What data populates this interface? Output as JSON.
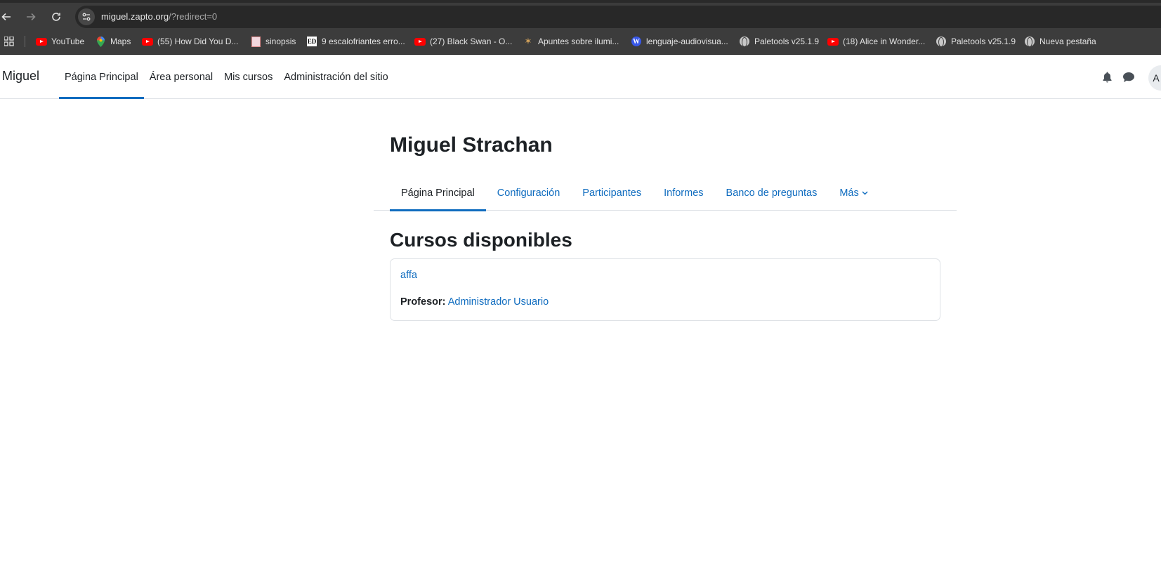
{
  "browser": {
    "url_host": "miguel.zapto.org",
    "url_path": "/?redirect=0",
    "bookmarks": [
      {
        "label": "YouTube",
        "icon": "youtube-icon"
      },
      {
        "label": "Maps",
        "icon": "maps-icon"
      },
      {
        "label": "(55) How Did You D...",
        "icon": "youtube-icon"
      },
      {
        "label": "sinopsis",
        "icon": "document-icon"
      },
      {
        "label": "9 escalofriantes erro...",
        "icon": "ed-icon"
      },
      {
        "label": "(27) Black Swan - O...",
        "icon": "youtube-icon"
      },
      {
        "label": "Apuntes sobre ilumi...",
        "icon": "figure-icon"
      },
      {
        "label": "lenguaje-audiovisua...",
        "icon": "wordpress-icon"
      },
      {
        "label": "Paletools v25.1.9",
        "icon": "globe-icon"
      },
      {
        "label": "(18) Alice in Wonder...",
        "icon": "youtube-icon"
      },
      {
        "label": "Paletools v25.1.9",
        "icon": "globe-icon"
      },
      {
        "label": "Nueva pestaña",
        "icon": "globe-icon"
      }
    ]
  },
  "site": {
    "brand": "Miguel",
    "primary_nav": [
      "Página Principal",
      "Área personal",
      "Mis cursos",
      "Administración del sitio"
    ],
    "avatar_initial": "A"
  },
  "page": {
    "title": "Miguel Strachan",
    "secondary_nav": [
      "Página Principal",
      "Configuración",
      "Participantes",
      "Informes",
      "Banco de preguntas",
      "Más"
    ],
    "section_title": "Cursos disponibles",
    "course": {
      "name": "affa",
      "teacher_label": "Profesor:",
      "teacher_name": "Administrador Usuario"
    }
  },
  "colors": {
    "accent": "#0f6cbf",
    "text": "#1d2125",
    "chrome_bg": "#3c3c3c"
  }
}
